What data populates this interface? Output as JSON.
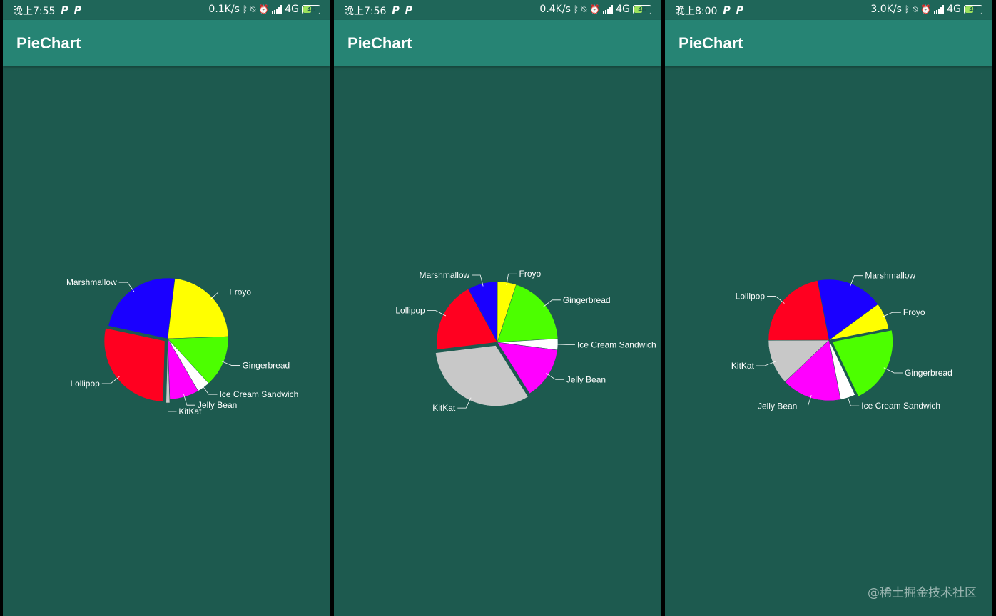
{
  "screens": [
    {
      "status": {
        "time": "晚上7:55",
        "speed": "0.1K/s",
        "network": "4G",
        "battery": "46"
      },
      "app_title": "PieChart"
    },
    {
      "status": {
        "time": "晚上7:56",
        "speed": "0.4K/s",
        "network": "4G",
        "battery": "46"
      },
      "app_title": "PieChart"
    },
    {
      "status": {
        "time": "晚上8:00",
        "speed": "3.0K/s",
        "network": "4G",
        "battery": "47"
      },
      "app_title": "PieChart"
    }
  ],
  "watermark": "@稀土掘金技术社区",
  "colors": {
    "background": "#1d5a4f",
    "app_bar": "#268474",
    "status_bar": "#1f6659"
  },
  "chart_data": [
    {
      "type": "pie",
      "categories": [
        "KitKat",
        "Lollipop",
        "Marshmallow",
        "Froyo",
        "Gingerbread",
        "Ice Cream Sandwich",
        "Jelly Bean"
      ],
      "colors": [
        "#c8c8c8",
        "#ff0020",
        "#1a00ff",
        "#ffff00",
        "#4cff00",
        "#ffffff",
        "#ff00ff"
      ],
      "values": [
        1,
        28.5,
        24,
        23,
        14,
        3.5,
        8
      ],
      "highlighted": [
        "Lollipop",
        "KitKat"
      ]
    },
    {
      "type": "pie",
      "categories": [
        "Lollipop",
        "Marshmallow",
        "Froyo",
        "Gingerbread",
        "Ice Cream Sandwich",
        "Jelly Bean",
        "KitKat"
      ],
      "colors": [
        "#ff0020",
        "#1a00ff",
        "#ffff00",
        "#4cff00",
        "#ffffff",
        "#ff00ff",
        "#c8c8c8"
      ],
      "values": [
        19,
        8,
        5,
        19,
        3,
        14,
        32
      ],
      "highlighted": [
        "KitKat"
      ]
    },
    {
      "type": "pie",
      "categories": [
        "Marshmallow",
        "Froyo",
        "Gingerbread",
        "Ice Cream Sandwich",
        "Jelly Bean",
        "KitKat",
        "Lollipop"
      ],
      "colors": [
        "#1a00ff",
        "#ffff00",
        "#4cff00",
        "#ffffff",
        "#ff00ff",
        "#c8c8c8",
        "#ff0020"
      ],
      "values": [
        18,
        7,
        21,
        4,
        16,
        12,
        22
      ],
      "highlighted": [
        "Gingerbread"
      ]
    }
  ]
}
